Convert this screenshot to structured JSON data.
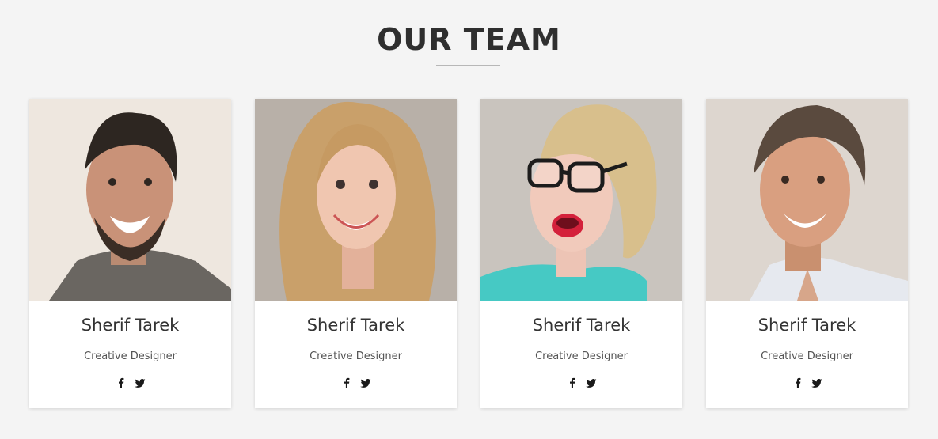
{
  "section": {
    "title": "OUR TEAM"
  },
  "team": [
    {
      "name": "Sherif Tarek",
      "role": "Creative Designer",
      "social": [
        "facebook-icon",
        "twitter-icon"
      ]
    },
    {
      "name": "Sherif Tarek",
      "role": "Creative Designer",
      "social": [
        "facebook-icon",
        "twitter-icon"
      ]
    },
    {
      "name": "Sherif Tarek",
      "role": "Creative Designer",
      "social": [
        "facebook-icon",
        "twitter-icon"
      ]
    },
    {
      "name": "Sherif Tarek",
      "role": "Creative Designer",
      "social": [
        "facebook-icon",
        "twitter-icon"
      ]
    }
  ],
  "colors": {
    "background": "#f4f4f4",
    "card": "#ffffff",
    "text": "#333333",
    "divider": "#b7b7b7"
  }
}
